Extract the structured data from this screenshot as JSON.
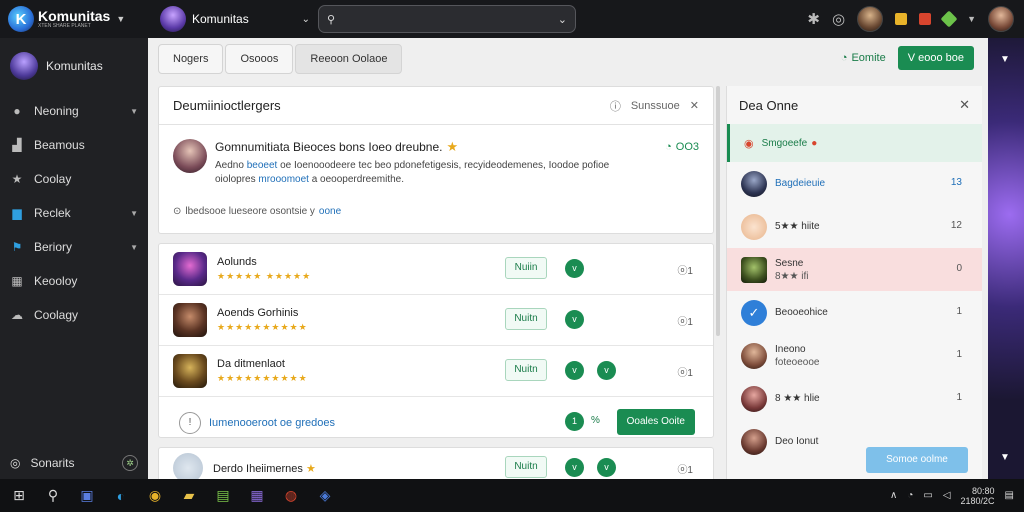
{
  "topbar": {
    "brand_name": "Komunitas",
    "brand_tagline": "XTEN SHARE PLANET",
    "community_name": "Komunitas",
    "search_placeholder": ""
  },
  "sidebar": {
    "community_name": "Komunitas",
    "items": [
      {
        "label": "Neoning",
        "icon": "circle-icon",
        "has_chevron": true
      },
      {
        "label": "Beamous",
        "icon": "chart-icon",
        "has_chevron": false
      },
      {
        "label": "Coolay",
        "icon": "star-icon",
        "has_chevron": false
      },
      {
        "label": "Reclek",
        "icon": "chat-icon",
        "has_chevron": true
      },
      {
        "label": "Beriory",
        "icon": "flag-icon",
        "has_chevron": true
      },
      {
        "label": "Keooloy",
        "icon": "grid-icon",
        "has_chevron": false
      },
      {
        "label": "Coolagy",
        "icon": "cloud-icon",
        "has_chevron": false
      }
    ],
    "bottom_label": "Sonarits"
  },
  "tabs": [
    {
      "label": "Nogers"
    },
    {
      "label": "Osooos"
    },
    {
      "label": "Reeoon Oolaoe"
    }
  ],
  "header_actions": {
    "link_label": "Eomite",
    "button_label": "V eooo boe"
  },
  "announcement": {
    "title": "Deumiinioctlergers",
    "right_label": "Sunssuoe",
    "post_title": "Gomnumitiata Bieoces bons Ioeo dreubne.",
    "post_text_a": "Aedno ",
    "post_text_hl1": "beoeet",
    "post_text_b": " oe Ioenooodeere tec beo pdonefetigesis, recyideodemenes, Ioodoe pofioe",
    "post_text_c": "oiolopres ",
    "post_text_hl2": "mrooomoet",
    "post_text_d": " a oeooperdreemithe.",
    "comment_count": "OO3",
    "footer_text": "lbedsooe lueseore osontsie y",
    "footer_link": "oone"
  },
  "rows": [
    {
      "name": "Aolunds",
      "stars": "★★★★★ ★★★★★",
      "pill": "Nuiin",
      "dots": [
        "v"
      ],
      "num": "ⓞ1"
    },
    {
      "name": "Aoends Gorhinis",
      "stars": "★★★★★★★★★★",
      "pill": "Nuitn",
      "dots": [
        "v"
      ],
      "num": "ⓞ1"
    },
    {
      "name": "Da ditmenlaot",
      "stars": "★★★★★★★★★★",
      "pill": "Nuitn",
      "dots": [
        "v",
        "v"
      ],
      "num": "ⓞ1"
    }
  ],
  "more_row": {
    "hint": "Iumenooeroot oe gredoes",
    "count": "1",
    "pct": "%",
    "button": "Ooales Ooite"
  },
  "last_row": {
    "name": "Derdo Iheiimernes",
    "pill": "Nuitn",
    "num": "ⓞ1"
  },
  "panel": {
    "title": "Dea Onne",
    "rows": [
      {
        "name": "Smgoeefe",
        "sub": "",
        "val": "",
        "kind": "hot"
      },
      {
        "name": "Bagdeieuie",
        "sub": "",
        "val": "13",
        "kind": "blue"
      },
      {
        "name": "5★★ hiite",
        "sub": "",
        "val": "12",
        "kind": "normal"
      },
      {
        "name": "Sesne",
        "sub": "8★★ ifi",
        "val": "0",
        "kind": "alert"
      },
      {
        "name": "Beooeohice",
        "sub": "",
        "val": "1",
        "kind": "normal"
      },
      {
        "name": "Ineono",
        "sub": "foteoeooe",
        "val": "1",
        "kind": "normal"
      },
      {
        "name": "8 ★★ hlie",
        "sub": "",
        "val": "1",
        "kind": "normal"
      },
      {
        "name": "Deo Ionut",
        "sub": "",
        "val": "",
        "kind": "normal"
      }
    ],
    "button": "Somoe oolme"
  },
  "taskbar": {
    "time": "80:80",
    "date": "2180/2C"
  },
  "colors": {
    "accent_green": "#1a8c52",
    "star": "#e8a91c",
    "link_blue": "#1f6fb8"
  }
}
